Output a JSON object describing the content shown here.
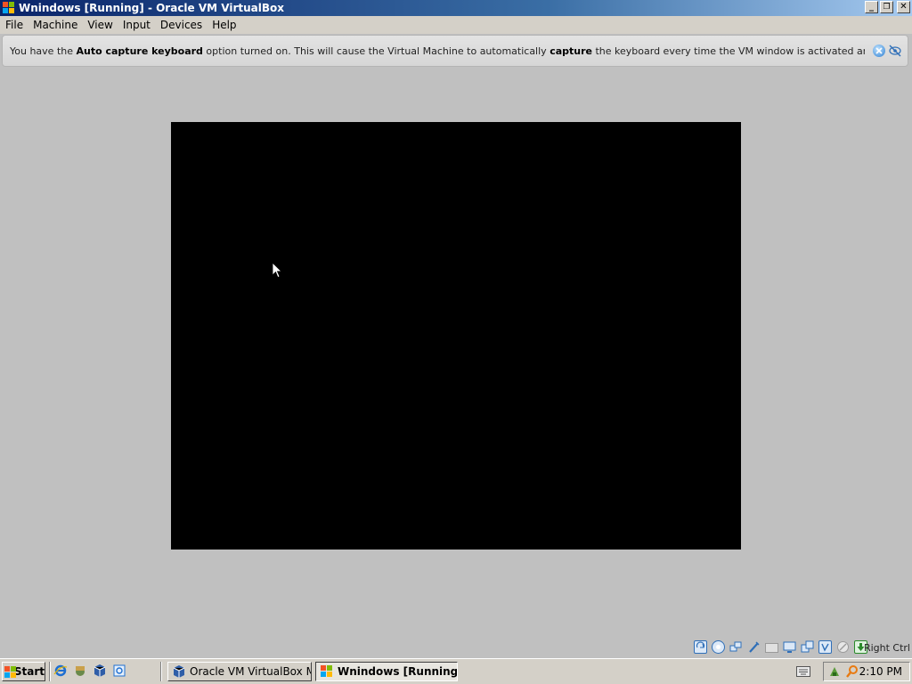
{
  "window": {
    "title": "Wnindows  [Running] - Oracle VM VirtualBox",
    "minimize_label": "_",
    "restore_label": "❐",
    "close_label": "✕"
  },
  "menubar": {
    "items": [
      "File",
      "Machine",
      "View",
      "Input",
      "Devices",
      "Help"
    ]
  },
  "notice": {
    "part1": "You have the ",
    "bold1": "Auto capture keyboard",
    "part2": " option turned on. This will cause the Virtual Machine to automatically ",
    "bold2": "capture",
    "part3": " the keyboard every time the VM window is activated and make it unavailable to",
    "icons": [
      "close-notice-icon",
      "dont-show-again-icon"
    ]
  },
  "vm_display": {
    "background": "#000000"
  },
  "statusbar": {
    "icons": [
      "hard-disk-icon",
      "optical-drive-icon",
      "network-icon",
      "usb-icon",
      "shared-folders-icon",
      "display-icon",
      "video-capture-icon",
      "virtualization-icon",
      "mouse-integration-icon",
      "keyboard-capture-icon"
    ],
    "host_key": "Right Ctrl"
  },
  "taskbar": {
    "start_label": "Start",
    "quick_launch": [
      "internet-explorer-icon",
      "windows-explorer-icon",
      "virtualbox-icon",
      "outlook-express-icon"
    ],
    "tasks": [
      {
        "label": "Oracle VM VirtualBox Ma...",
        "active": false
      },
      {
        "label": "Wnindows  [Running...",
        "active": true
      }
    ],
    "tray_icons": [
      "network-tray-icon",
      "search-tray-icon"
    ],
    "clock": "2:10 PM"
  },
  "colors": {
    "titlebar_start": "#0a246a",
    "titlebar_end": "#a6caf0",
    "chrome": "#d4d0c8",
    "workspace": "#c0c0c0"
  }
}
